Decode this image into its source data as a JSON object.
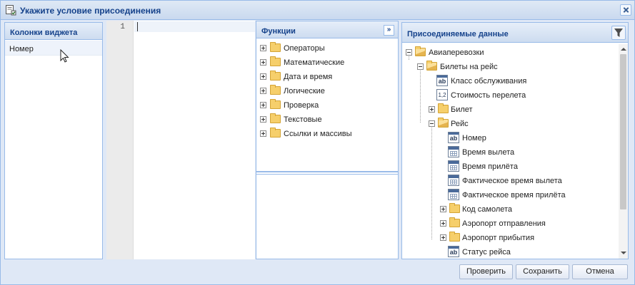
{
  "dialog": {
    "title": "Укажите условие присоединения",
    "title_icon": "edit-condition-icon",
    "close_icon": "close-icon"
  },
  "left_panel": {
    "header": "Колонки виджета",
    "items": [
      "Номер"
    ]
  },
  "editor": {
    "line_numbers": [
      "1"
    ],
    "content": ""
  },
  "functions_panel": {
    "header": "Функции",
    "expand_icon": "double-chevron-right-icon",
    "items": [
      "Операторы",
      "Математические",
      "Дата и время",
      "Логические",
      "Проверка",
      "Текстовые",
      "Ссылки и массивы"
    ],
    "description": ""
  },
  "data_panel": {
    "header": "Присоединяемые данные",
    "filter_icon": "filter-icon",
    "tree": [
      {
        "label": "Авиаперевозки",
        "type": "folder",
        "state": "expanded",
        "level": 0
      },
      {
        "label": "Билеты на рейс",
        "type": "folder",
        "state": "expanded",
        "level": 1
      },
      {
        "label": "Класс обслуживания",
        "type": "text",
        "icon_text": "ab",
        "level": 2
      },
      {
        "label": "Стоимость перелета",
        "type": "number",
        "icon_text": "1,2",
        "level": 2
      },
      {
        "label": "Билет",
        "type": "folder",
        "state": "collapsed",
        "level": 2
      },
      {
        "label": "Рейс",
        "type": "folder",
        "state": "expanded",
        "level": 2
      },
      {
        "label": "Номер",
        "type": "text",
        "icon_text": "ab",
        "level": 3
      },
      {
        "label": "Время вылета",
        "type": "date",
        "level": 3
      },
      {
        "label": "Время прилёта",
        "type": "date",
        "level": 3
      },
      {
        "label": "Фактическое время вылета",
        "type": "date",
        "level": 3
      },
      {
        "label": "Фактическое время прилёта",
        "type": "date",
        "level": 3
      },
      {
        "label": "Код самолета",
        "type": "folder",
        "state": "collapsed",
        "level": 3
      },
      {
        "label": "Аэропорт отправления",
        "type": "folder",
        "state": "collapsed",
        "level": 3
      },
      {
        "label": "Аэропорт прибытия",
        "type": "folder",
        "state": "collapsed",
        "level": 3
      },
      {
        "label": "Статус рейса",
        "type": "text",
        "icon_text": "ab",
        "level": 3
      }
    ]
  },
  "buttons": {
    "check": "Проверить",
    "save": "Сохранить",
    "cancel": "Отмена"
  },
  "colors": {
    "accent": "#15428b",
    "border": "#99bbe8",
    "background": "#dfe8f6",
    "folder": "#f6cf6b"
  }
}
